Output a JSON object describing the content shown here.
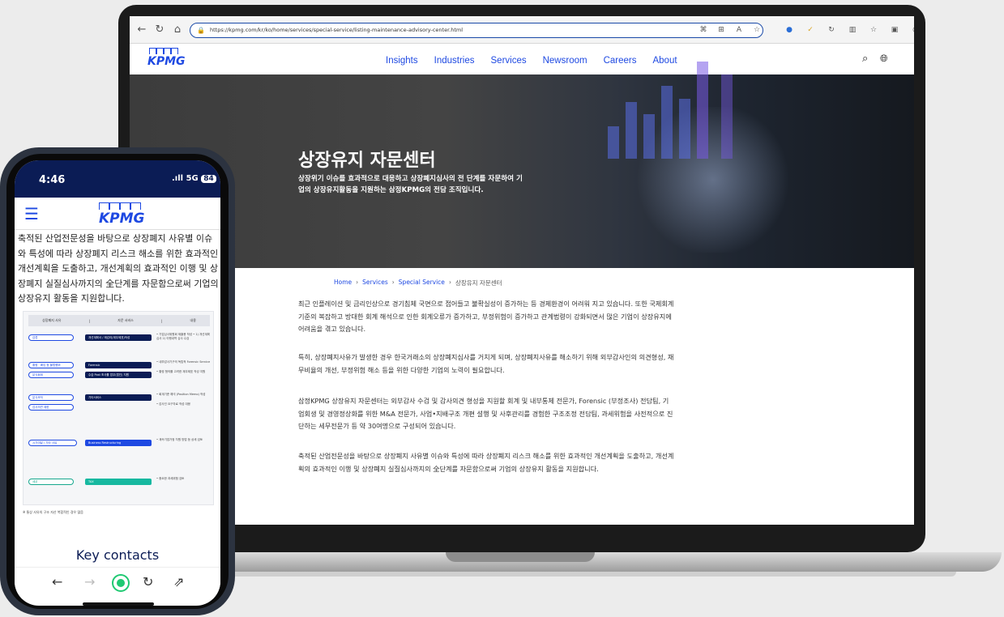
{
  "browser": {
    "url": "https://kpmg.com/kr/ko/home/services/special-service/listing-maintenance-advisory-center.html"
  },
  "site": {
    "logo": "KPMG",
    "nav": [
      "Insights",
      "Industries",
      "Services",
      "Newsroom",
      "Careers",
      "About"
    ]
  },
  "hero": {
    "title": "상장유지 자문센터",
    "subtitle": "상장위기 이슈를 효과적으로 대응하고 상장폐지심사의 전 단계를 자문하여 기업의 상장유지활동을 지원하는 삼정KPMG의 전담 조직입니다."
  },
  "breadcrumb": {
    "home": "Home",
    "services": "Services",
    "special": "Special Service",
    "current": "상장유지 자문센터"
  },
  "paragraphs": [
    "최근 인플레이션 및 금리인상으로 경기침체 국면으로 접어들고 불확실성이 증가하는 등 경제환경이 어려워 지고 있습니다. 또한 국제회계기준의 복잡하고 방대한 회계 해석으로 인한 회계오류가 증가하고, 부정위험이 증가하고 관계법령이 강화되면서 많은 기업이 상장유지에 어려움을 겪고 있습니다.",
    "특히, 상장폐지사유가 발생한 경우 한국거래소의 상장폐지심사를 거치게 되며, 상장폐지사유를 해소하기 위해 외부감사인의 의견형성, 재무비율의 개선, 부정위험 해소 등을 위한 다양한 기업의 노력이 필요합니다.",
    "삼정KPMG 상장유지 자문센터는 외부감사 수검 및 감사의견 형성을 지원할 회계 및 내부통제 전문가, Forensic (부정조사) 전담팀, 기업회생 및 경영정상화를 위한 M&A 전문가, 사업•지배구조 개편 설행 및 사후관리를 경험한 구조조정 전담팀, 과세위험을 사전적으로 진단하는 세무전문가 등 약 30여명으로 구성되어 있습니다.",
    "축적된 산업전문성을 바탕으로 상장폐지 사유별 이슈와 특성에 따라 상장폐지 리스크 해소를 위한 효과적인 개선계획을 도출하고, 개선계획의 효과적인 이행 및 상장폐지 실질심사까지의 全단계를 자문함으로써 기업의 상장유지 활동을 지원합니다."
  ],
  "phone": {
    "time": "4:46",
    "signal": ".ıll 5G",
    "battery": "84",
    "logo": "KPMG",
    "text": "축적된 산업전문성을 바탕으로 상장폐지 사유별 이슈와 특성에 따라 상장폐지 리스크 해소를 위한 효과적인 개선계획을 도출하고, 개선계획의 효과적인 이행 및 상장폐지 실질심사까지의 全단계를 자문함으로써 기업의 상장유지 활동을 지원합니다.",
    "diagram": {
      "headers": [
        "상장폐지 사유",
        "|",
        "자문 서비스",
        "|",
        "내용"
      ],
      "rows": [
        {
          "reason": "감류",
          "service": "개선계획서 / 재감리(재무제표)작성",
          "note": "• 기업심사위원회 제출용 작성\n• 1) 개선계획 심사 2) 이행내역 심사 수검"
        },
        {
          "reason": "횡령 · 배임 등 불법행위",
          "service": "Forensic",
          "note": "• 내부감사기구의 독립적 Forensic Service"
        },
        {
          "reason": "분식회계",
          "service": "수습 Post 조사를 업무(법인) 지원",
          "note": "• 횡령 혐의를 고려한 재무제표 작성 지원"
        },
        {
          "reason": "분식조작",
          "service": "기타서비스",
          "note": "• 회계기준 해석 (Position Memo) 작성"
        },
        {
          "reason": "감사의견 제한",
          "service": "",
          "note": "• 감사인 요구자료 작성 대응"
        },
        {
          "reason": "시가미달 / 기타 사유",
          "service": "Business Restructuring",
          "note": "• 계속기업가정 차원 방법 등 상세 검토"
        },
        {
          "reason": "세무",
          "service": "TAX",
          "note": "• 중요한 과세위험 검토"
        }
      ],
      "footnote": "※ 통상 사유의 구조 자산 복합적인 경우 많음"
    },
    "key_contacts": "Key contacts"
  },
  "icons": [
    "back-icon",
    "forward-icon",
    "home-icon",
    "lock-icon",
    "search-icon",
    "globe-icon",
    "hamburger-icon",
    "refresh-icon",
    "share-icon"
  ],
  "colors": {
    "kpmg_blue": "#1e49e2",
    "kpmg_navy": "#0b1c55",
    "teal": "#17b8a0"
  }
}
